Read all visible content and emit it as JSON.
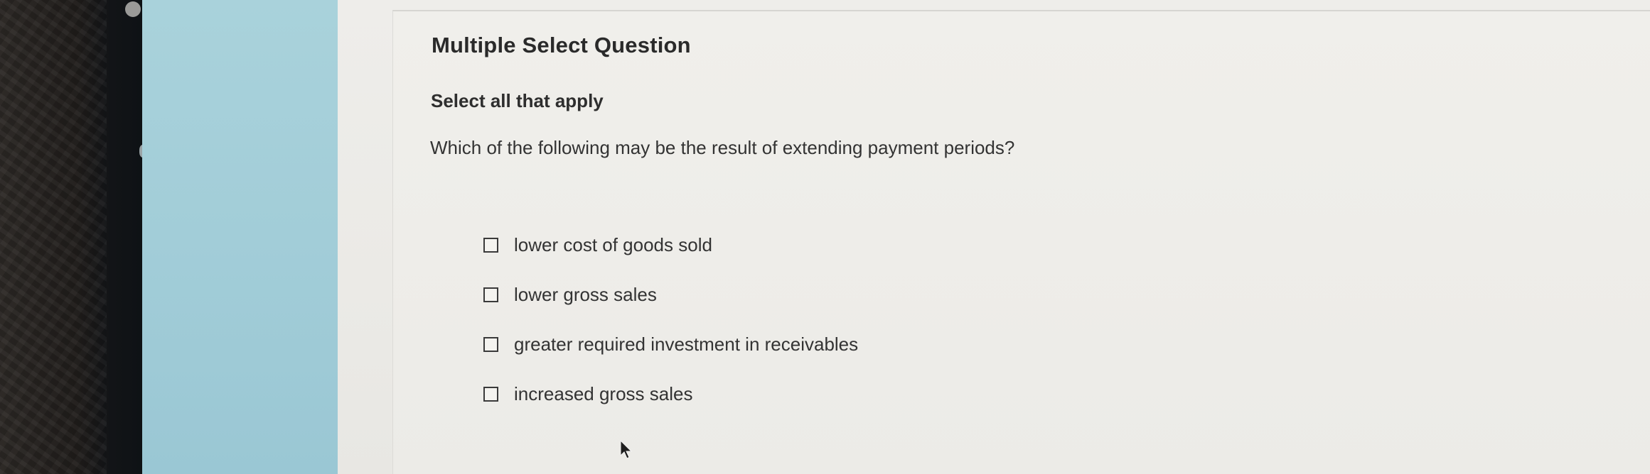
{
  "question": {
    "title": "Multiple Select Question",
    "instruction": "Select all that apply",
    "prompt": "Which of the following may be the result of extending payment periods?",
    "options": [
      {
        "label": "lower cost of goods sold",
        "checked": false
      },
      {
        "label": "lower gross sales",
        "checked": false
      },
      {
        "label": "greater required investment in receivables",
        "checked": false
      },
      {
        "label": "increased gross sales",
        "checked": false
      }
    ]
  },
  "colors": {
    "side_panel": "#a2cdd8",
    "page_background": "#ecebe7",
    "text": "#333333"
  },
  "icons": {
    "checkbox": "empty-square",
    "cursor": "arrow-pointer"
  }
}
